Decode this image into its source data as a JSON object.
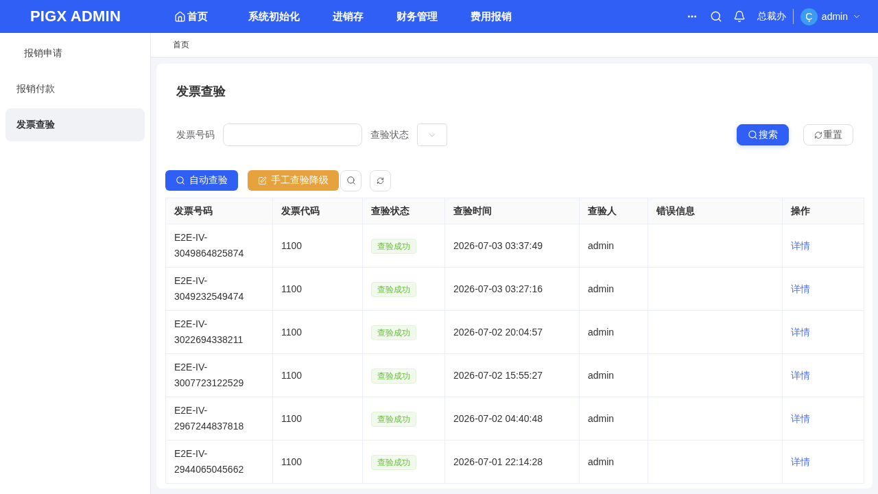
{
  "header": {
    "logo": "PIGX ADMIN",
    "nav": [
      {
        "label": "首页",
        "kind": "home"
      },
      {
        "label": "系统初始化",
        "kind": "menu"
      },
      {
        "label": "进销存",
        "kind": "menu"
      },
      {
        "label": "财务管理",
        "kind": "menu"
      },
      {
        "label": "费用报销",
        "kind": "menu"
      }
    ],
    "org": "总裁办",
    "user": {
      "avatar_letter": "Ç",
      "name": "admin"
    }
  },
  "sidebar": {
    "items": [
      {
        "label": "报销申请",
        "kind": "submenu",
        "selected": false
      },
      {
        "label": "报销付款",
        "kind": "menu",
        "selected": false
      },
      {
        "label": "发票查验",
        "kind": "menu",
        "selected": true
      }
    ]
  },
  "breadcrumb": [
    "首页"
  ],
  "page": {
    "title": "发票查验"
  },
  "filters": {
    "fields": [
      {
        "label": "发票号码",
        "kind": "text"
      },
      {
        "label": "查验状态",
        "kind": "select"
      }
    ],
    "buttons": [
      {
        "label": "搜索",
        "kind": "primary"
      },
      {
        "label": "重置",
        "kind": "default"
      }
    ]
  },
  "toolbar": {
    "buttons": [
      {
        "label": "自动查验",
        "kind": "primary"
      },
      {
        "label": "手工查验降级",
        "kind": "warning"
      }
    ]
  },
  "table": {
    "columns": [
      "发票号码",
      "发票代码",
      "查验状态",
      "查验时间",
      "查验人",
      "错误信息",
      "操作"
    ],
    "rows": [
      {
        "invoice_number": "E2E-IV-3049864825874",
        "invoice_code": "1100",
        "status": {
          "label": "查验成功",
          "kind": "success"
        },
        "time": "2026-07-03 03:37:49",
        "inspector": "admin",
        "action": "详情"
      },
      {
        "invoice_number": "E2E-IV-3049232549474",
        "invoice_code": "1100",
        "status": {
          "label": "查验成功",
          "kind": "success"
        },
        "time": "2026-07-03 03:27:16",
        "inspector": "admin",
        "action": "详情"
      },
      {
        "invoice_number": "E2E-IV-3022694338211",
        "invoice_code": "1100",
        "status": {
          "label": "查验成功",
          "kind": "success"
        },
        "time": "2026-07-02 20:04:57",
        "inspector": "admin",
        "action": "详情"
      },
      {
        "invoice_number": "E2E-IV-3007723122529",
        "invoice_code": "1100",
        "status": {
          "label": "查验成功",
          "kind": "success"
        },
        "time": "2026-07-02 15:55:27",
        "inspector": "admin",
        "action": "详情"
      },
      {
        "invoice_number": "E2E-IV-2967244837818",
        "invoice_code": "1100",
        "status": {
          "label": "查验成功",
          "kind": "success"
        },
        "time": "2026-07-02 04:40:48",
        "inspector": "admin",
        "action": "详情"
      },
      {
        "invoice_number": "E2E-IV-2944065045662",
        "invoice_code": "1100",
        "status": {
          "label": "查验成功",
          "kind": "success"
        },
        "time": "2026-07-01 22:14:28",
        "inspector": "admin",
        "action": "详情"
      }
    ]
  }
}
